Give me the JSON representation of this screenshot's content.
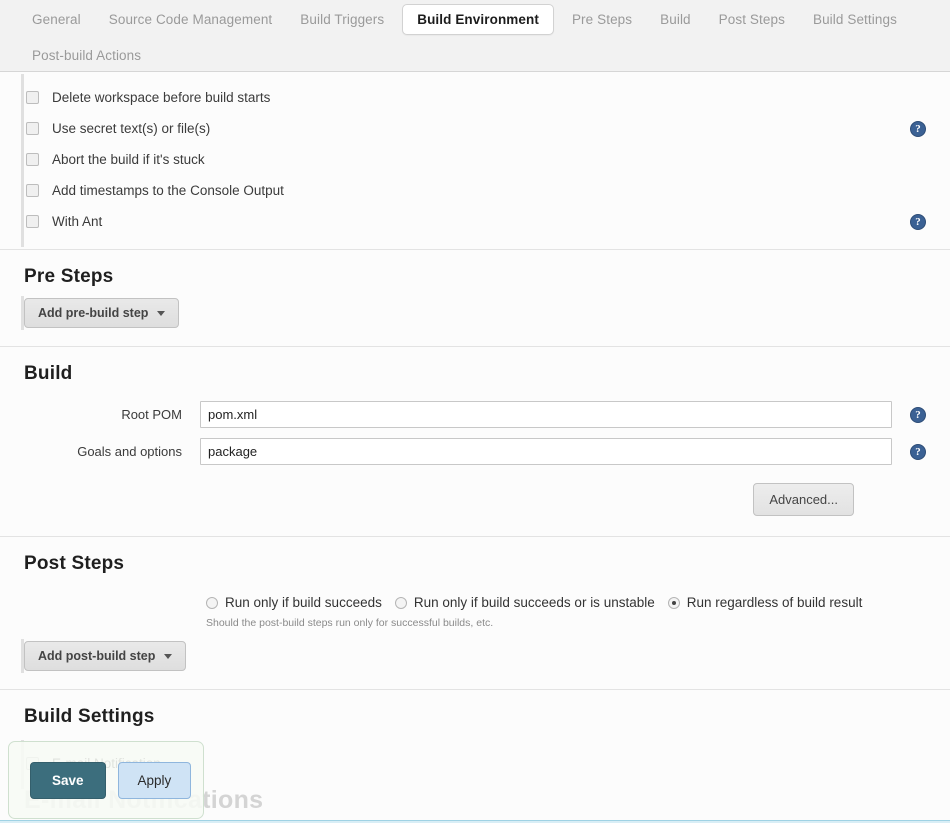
{
  "tabs": {
    "row1": [
      {
        "label": "General",
        "active": false
      },
      {
        "label": "Source Code Management",
        "active": false
      },
      {
        "label": "Build Triggers",
        "active": false
      },
      {
        "label": "Build Environment",
        "active": true
      },
      {
        "label": "Pre Steps",
        "active": false
      },
      {
        "label": "Build",
        "active": false
      },
      {
        "label": "Post Steps",
        "active": false
      },
      {
        "label": "Build Settings",
        "active": false
      }
    ],
    "row2": [
      {
        "label": "Post-build Actions",
        "active": false
      }
    ]
  },
  "build_environment": {
    "options": [
      {
        "label": "Delete workspace before build starts",
        "checked": false,
        "help": false
      },
      {
        "label": "Use secret text(s) or file(s)",
        "checked": false,
        "help": true
      },
      {
        "label": "Abort the build if it's stuck",
        "checked": false,
        "help": false
      },
      {
        "label": "Add timestamps to the Console Output",
        "checked": false,
        "help": false
      },
      {
        "label": "With Ant",
        "checked": false,
        "help": true
      }
    ],
    "help_glyph": "?"
  },
  "pre_steps": {
    "title": "Pre Steps",
    "add_button": "Add pre-build step"
  },
  "build": {
    "title": "Build",
    "fields": [
      {
        "label": "Root POM",
        "value": "pom.xml",
        "help": true
      },
      {
        "label": "Goals and options",
        "value": "package",
        "help": true
      }
    ],
    "advanced_button": "Advanced..."
  },
  "post_steps": {
    "title": "Post Steps",
    "radios": [
      {
        "label": "Run only if build succeeds",
        "selected": false
      },
      {
        "label": "Run only if build succeeds or is unstable",
        "selected": false
      },
      {
        "label": "Run regardless of build result",
        "selected": true
      }
    ],
    "hint": "Should the post-build steps run only for successful builds, etc.",
    "add_button": "Add post-build step"
  },
  "build_settings": {
    "title": "Build Settings",
    "options": [
      {
        "label": "E-mail Notification",
        "checked": false
      }
    ],
    "obscured_heading": "E-mail Notifications"
  },
  "action_bar": {
    "save_label": "Save",
    "apply_label": "Apply",
    "save_color": "#3c6e7d",
    "apply_color": "#cfe3f5"
  }
}
